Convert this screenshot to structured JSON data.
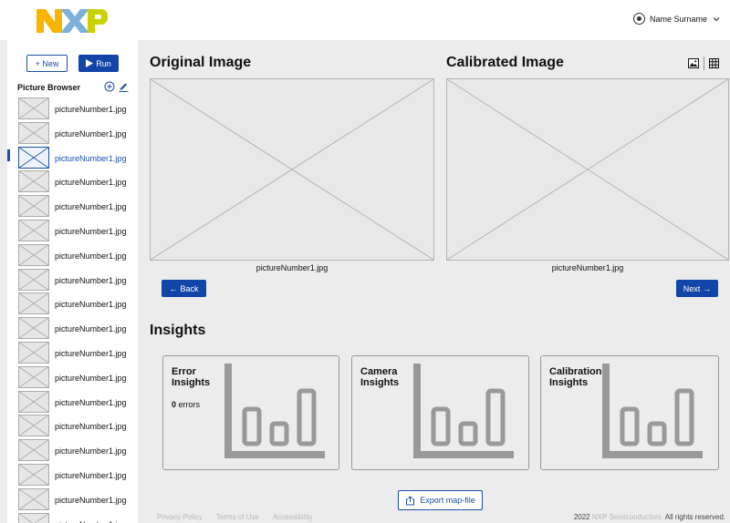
{
  "header": {
    "logo_text": "NXP",
    "user_name": "Name Surname"
  },
  "sidebar": {
    "new_label": "+ New",
    "run_label": "Run",
    "browser_title": "Picture Browser",
    "active_index": 2,
    "pictures": [
      "pictureNumber1.jpg",
      "pictureNumber1.jpg",
      "pictureNumber1.jpg",
      "pictureNumber1.jpg",
      "pictureNumber1.jpg",
      "pictureNumber1.jpg",
      "pictureNumber1.jpg",
      "pictureNumber1.jpg",
      "pictureNumber1.jpg",
      "pictureNumber1.jpg",
      "pictureNumber1.jpg",
      "pictureNumber1.jpg",
      "pictureNumber1.jpg",
      "pictureNumber1.jpg",
      "pictureNumber1.jpg",
      "pictureNumber1.jpg",
      "pictureNumber1.jpg",
      "pictureNumber1.jpg"
    ]
  },
  "main": {
    "original_title": "Original Image",
    "calibrated_title": "Calibrated Image",
    "original_caption": "pictureNumber1.jpg",
    "calibrated_caption": "pictureNumber1.jpg",
    "back_label": "Back",
    "next_label": "Next",
    "insights_title": "Insights",
    "cards": [
      {
        "title": "Error Insights",
        "count": "0",
        "count_suffix": " errors"
      },
      {
        "title": "Camera Insights"
      },
      {
        "title": "Calibration Insights"
      }
    ],
    "export_label": "Export map-file"
  },
  "footer": {
    "links": [
      "Privacy Policy",
      "Terms of Use",
      "Accessibility"
    ],
    "copyright_year": "2022",
    "copyright_company": "NXP Semiconductors.",
    "copyright_rest": "All rights reserved."
  },
  "colors": {
    "accent": "#1245a8",
    "logo_orange": "#f9b500",
    "logo_blue": "#7bb1db",
    "logo_green": "#c9d200"
  }
}
